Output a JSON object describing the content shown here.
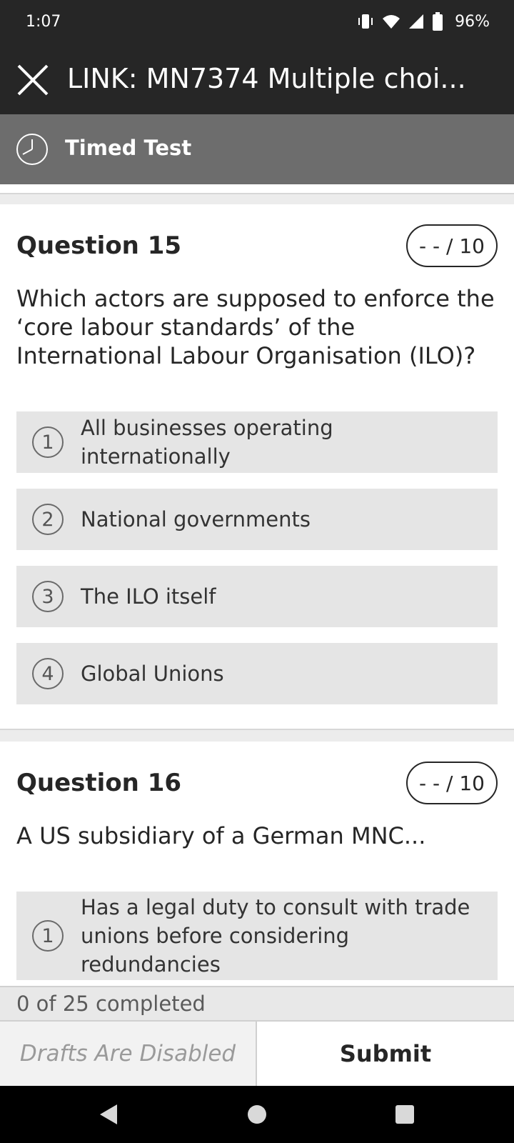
{
  "status_bar": {
    "time": "1:07",
    "battery": "96%",
    "icons": [
      "vibrate-icon",
      "wifi-icon",
      "signal-icon",
      "battery-icon"
    ]
  },
  "app_bar": {
    "title": "LINK: MN7374 Multiple choi...",
    "close_icon": "close-icon"
  },
  "timer_bar": {
    "label": "Timed Test",
    "icon": "clock-icon"
  },
  "questions": [
    {
      "title": "Question 15",
      "score": "- - / 10",
      "text": "Which actors are supposed to enforce the ‘core labour standards’ of the International Labour Organisation (ILO)?",
      "options": [
        {
          "number": "1",
          "label": "All businesses operating internationally"
        },
        {
          "number": "2",
          "label": "National governments"
        },
        {
          "number": "3",
          "label": "The ILO itself"
        },
        {
          "number": "4",
          "label": "Global Unions"
        }
      ]
    },
    {
      "title": "Question 16",
      "score": "- - / 10",
      "text": "A US subsidiary of a German MNC...",
      "options": [
        {
          "number": "1",
          "label": "Has a legal duty to consult with trade unions before considering redundancies"
        }
      ]
    }
  ],
  "progress": {
    "text": "0 of 25 completed"
  },
  "footer": {
    "drafts_label": "Drafts Are Disabled",
    "submit_label": "Submit"
  },
  "nav_bar": {
    "icons": [
      "back-icon",
      "home-icon",
      "recents-icon"
    ]
  },
  "colors": {
    "header_bg": "#262626",
    "timer_bg": "#6d6d6d",
    "option_bg": "#e5e5e5"
  }
}
